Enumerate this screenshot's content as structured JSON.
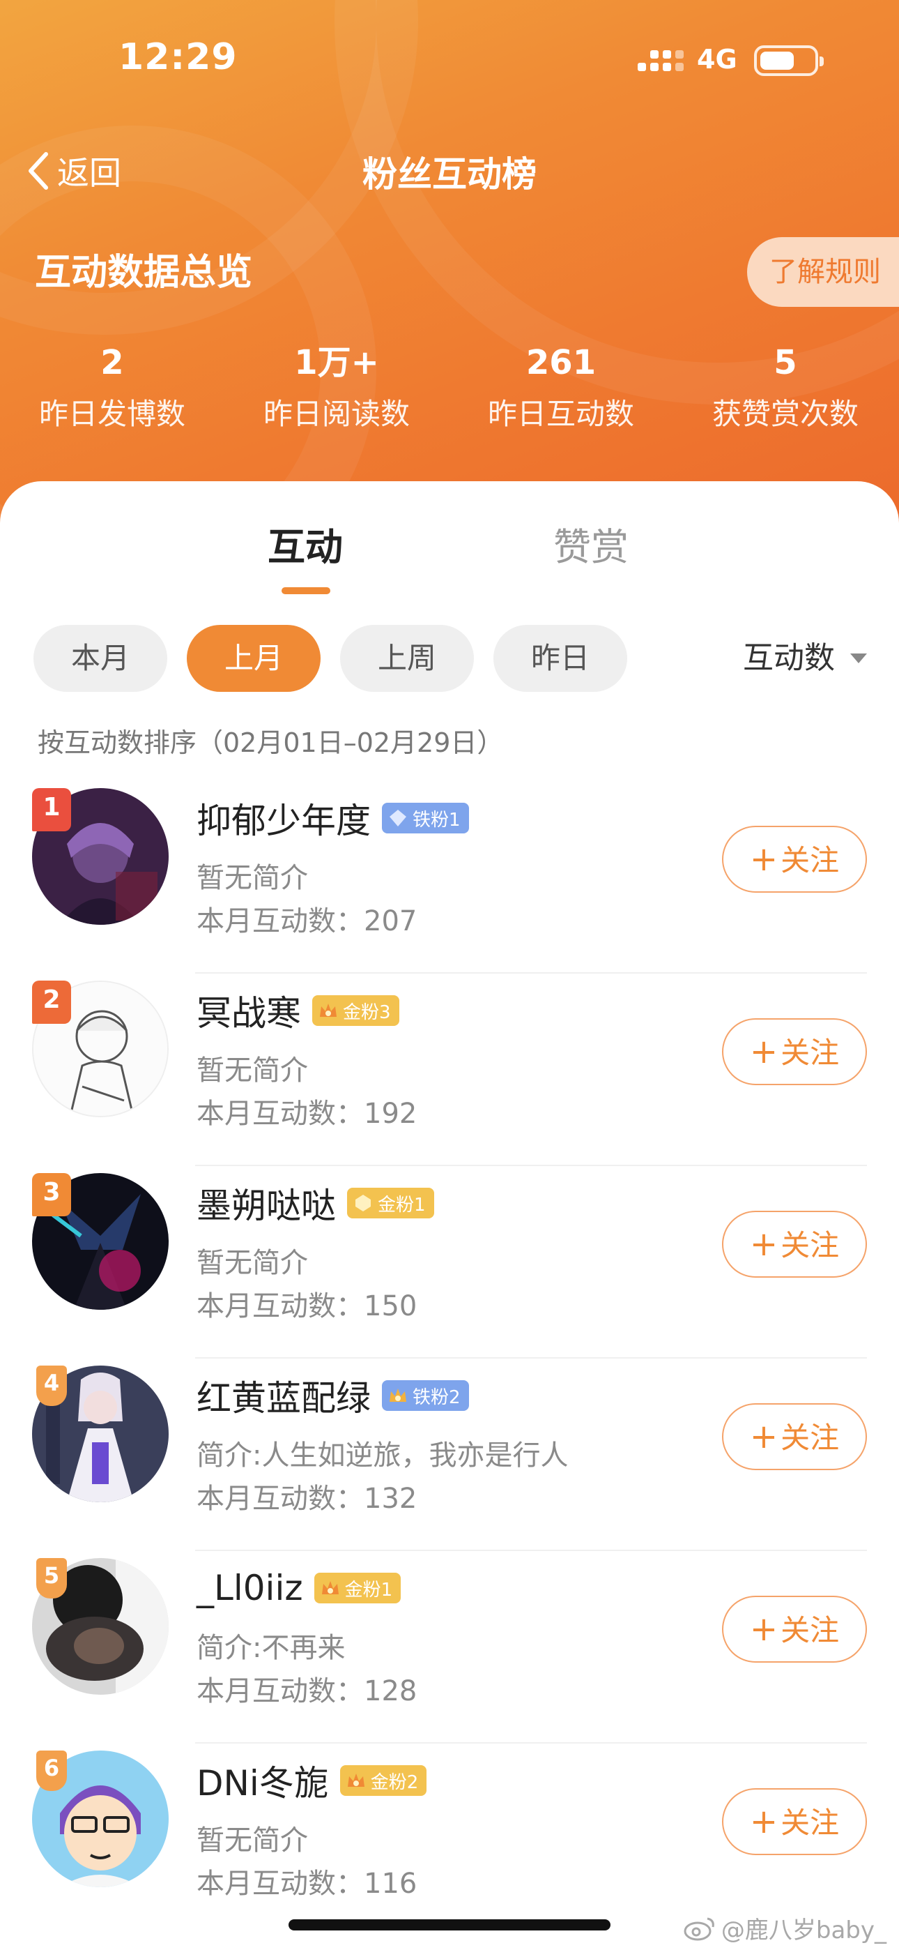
{
  "status": {
    "time": "12:29",
    "network": "4G"
  },
  "nav": {
    "back_label": "返回",
    "title": "粉丝互动榜"
  },
  "overview": {
    "title": "互动数据总览",
    "rules_label": "了解规则",
    "stats": [
      {
        "value": "2",
        "label": "昨日发博数"
      },
      {
        "value": "1万+",
        "label": "昨日阅读数"
      },
      {
        "value": "261",
        "label": "昨日互动数"
      },
      {
        "value": "5",
        "label": "获赞赏次数"
      }
    ]
  },
  "tabs": [
    {
      "label": "互动",
      "active": true
    },
    {
      "label": "赞赏",
      "active": false
    }
  ],
  "filters": {
    "chips": [
      {
        "label": "本月",
        "active": false
      },
      {
        "label": "上月",
        "active": true
      },
      {
        "label": "上周",
        "active": false
      },
      {
        "label": "昨日",
        "active": false
      }
    ],
    "sort_label": "互动数"
  },
  "range_note": "按互动数排序（02月01日–02月29日）",
  "fans": [
    {
      "rank": "1",
      "name": "抑郁少年度",
      "badge": "铁粉1",
      "badge_type": "iron",
      "bio": "暂无简介",
      "count_text": "本月互动数：207",
      "follow_label": "关注"
    },
    {
      "rank": "2",
      "name": "冥战寒",
      "badge": "金粉3",
      "badge_type": "gold",
      "bio": "暂无简介",
      "count_text": "本月互动数：192",
      "follow_label": "关注"
    },
    {
      "rank": "3",
      "name": "墨朔哒哒",
      "badge": "金粉1",
      "badge_type": "gold",
      "bio": "暂无简介",
      "count_text": "本月互动数：150",
      "follow_label": "关注"
    },
    {
      "rank": "4",
      "name": "红黄蓝配绿",
      "badge": "铁粉2",
      "badge_type": "iron",
      "bio": "简介:人生如逆旅，我亦是行人",
      "count_text": "本月互动数：132",
      "follow_label": "关注"
    },
    {
      "rank": "5",
      "name": "_Ll0iiz",
      "badge": "金粉1",
      "badge_type": "gold",
      "bio": "简介:不再来",
      "count_text": "本月互动数：128",
      "follow_label": "关注"
    },
    {
      "rank": "6",
      "name": "DNi冬旎",
      "badge": "金粉2",
      "badge_type": "gold",
      "bio": "暂无简介",
      "count_text": "本月互动数：116",
      "follow_label": "关注"
    }
  ],
  "watermark": "@鹿八岁baby_",
  "colors": {
    "brand": "#f08a35",
    "iron_badge": "#7ea4ec",
    "gold_badge": "#f3c24f"
  }
}
